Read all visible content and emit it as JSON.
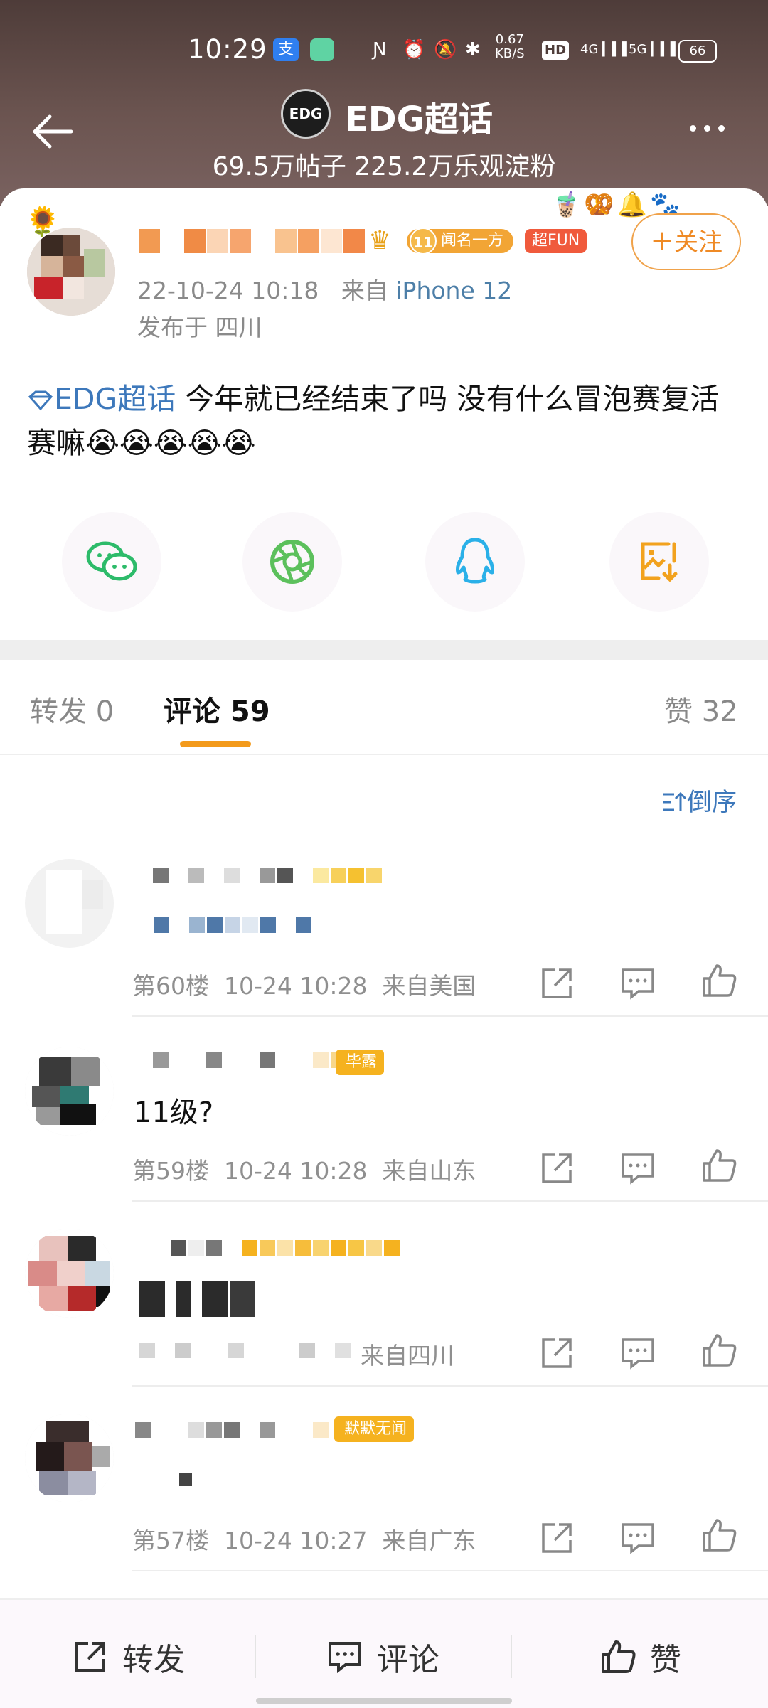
{
  "status": {
    "time": "10:29",
    "net_speed_top": "0.67",
    "net_speed_bottom": "KB/S",
    "hd": "HD",
    "net1": "4G",
    "net2": "5G",
    "battery": "66"
  },
  "header": {
    "logo_text": "EDG",
    "title": "EDG超话",
    "subtitle": "69.5万帖子 225.2万乐观淀粉"
  },
  "post": {
    "level_badge_num": "11",
    "level_badge_text": "闻名一方",
    "fun_badge": "超FUN",
    "follow": "＋关注",
    "time": "22-10-24 10:18",
    "from_prefix": "来自",
    "device": "iPhone 12",
    "location": "发布于 四川",
    "topic_tag": "EDG超话",
    "text": " 今年就已经结束了吗 没有什么冒泡赛复活赛嘛",
    "emojis": "😭😭😭😭😭"
  },
  "tabs": {
    "repost": "转发 0",
    "comment": "评论 59",
    "like": "赞 32"
  },
  "sort_label": "倒序",
  "comments": [
    {
      "text": "",
      "meta": "第60楼  10-24 10:28  来自美国",
      "badge": ""
    },
    {
      "text": "11级?",
      "meta": "第59楼  10-24 10:28  来自山东",
      "badge": "毕露"
    },
    {
      "text": "",
      "meta": "  来自四川",
      "badge": ""
    },
    {
      "text": "",
      "meta": "第57楼  10-24 10:27  来自广东",
      "badge": "默默无闻"
    }
  ],
  "bottom": {
    "repost": "转发",
    "comment": "评论",
    "like": "赞"
  },
  "colors": {
    "accent": "#f39a1b",
    "link": "#3d78bb",
    "follow": "#ef8a25"
  }
}
